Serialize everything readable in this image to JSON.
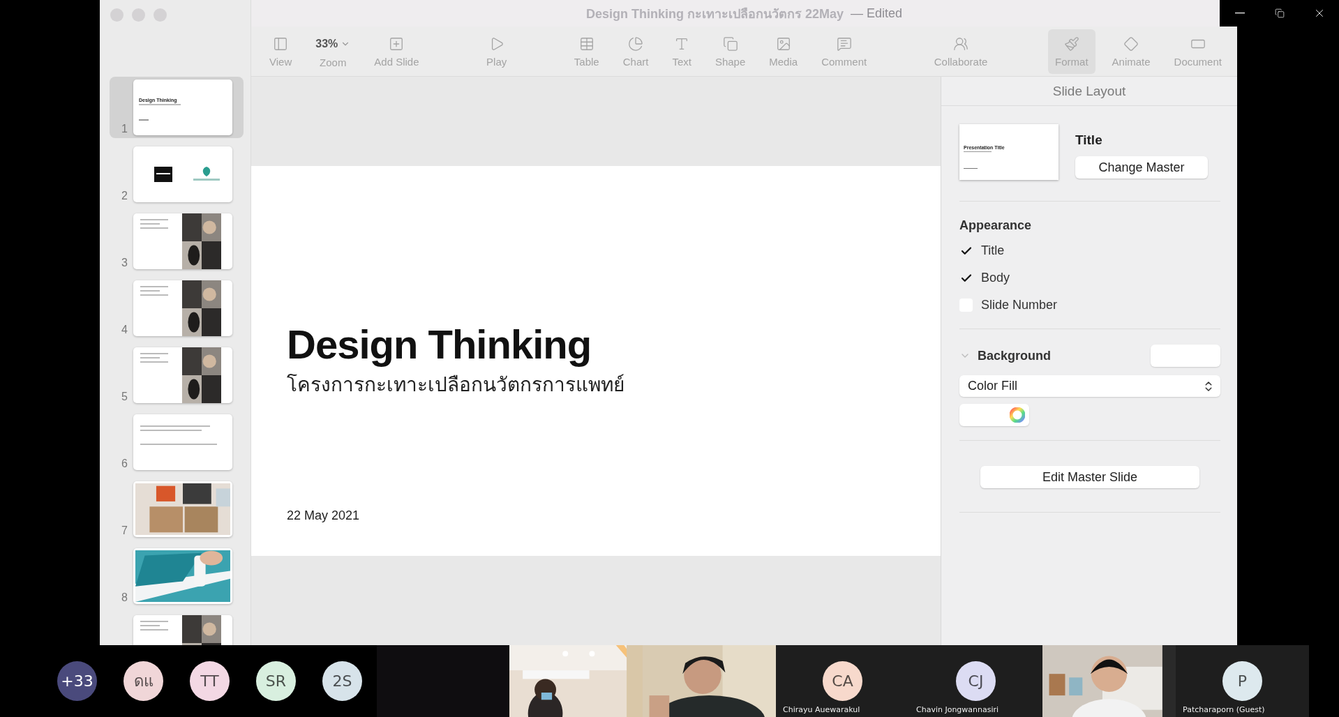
{
  "window": {
    "title": "Design Thinking กะเทาะเปลือกนวัตกร 22May",
    "status": "— Edited"
  },
  "toolbar": {
    "groups": [
      [
        {
          "kind": "view",
          "label": "View",
          "selected": false
        },
        {
          "kind": "zoom",
          "value": "33%",
          "label": "Zoom",
          "selected": false
        },
        {
          "kind": "add-slide",
          "label": "Add Slide",
          "selected": false
        }
      ],
      [
        {
          "kind": "play",
          "label": "Play",
          "selected": false
        }
      ],
      [
        {
          "kind": "table",
          "label": "Table",
          "selected": false
        },
        {
          "kind": "chart",
          "label": "Chart",
          "selected": false
        },
        {
          "kind": "text",
          "label": "Text",
          "selected": false
        },
        {
          "kind": "shape",
          "label": "Shape",
          "selected": false
        },
        {
          "kind": "media",
          "label": "Media",
          "selected": false
        },
        {
          "kind": "comment",
          "label": "Comment",
          "selected": false
        }
      ],
      [
        {
          "kind": "collaborate",
          "label": "Collaborate",
          "selected": false
        }
      ],
      [
        {
          "kind": "format",
          "label": "Format",
          "selected": true
        },
        {
          "kind": "animate",
          "label": "Animate",
          "selected": false
        },
        {
          "kind": "document",
          "label": "Document",
          "selected": false
        }
      ]
    ]
  },
  "slides": [
    {
      "number": "1",
      "kind": "title",
      "title": "Design Thinking",
      "selected": true
    },
    {
      "number": "2",
      "kind": "logos",
      "selected": false
    },
    {
      "number": "3",
      "kind": "collage",
      "selected": false
    },
    {
      "number": "4",
      "kind": "collage",
      "selected": false
    },
    {
      "number": "5",
      "kind": "collage",
      "selected": false
    },
    {
      "number": "6",
      "kind": "text",
      "selected": false
    },
    {
      "number": "7",
      "selected": false
    },
    {
      "number": "8",
      "selected": false
    },
    {
      "kind": "collage",
      "selected": false
    }
  ],
  "canvas": {
    "title": "Design Thinking",
    "subtitle": "โครงการกะเทาะเปลือกนวัตกรการแพทย์",
    "date": "22 May 2021"
  },
  "panel": {
    "header": "Slide Layout",
    "layout_thumbnail_title": "Presentation Title",
    "layout_name": "Title",
    "change_master": "Change Master",
    "appearance_heading": "Appearance",
    "appearance": [
      {
        "label": "Title",
        "checked": true
      },
      {
        "label": "Body",
        "checked": true
      },
      {
        "label": "Slide Number",
        "checked": false
      }
    ],
    "background_heading": "Background",
    "fill": "Color Fill",
    "edit_master": "Edit Master Slide"
  },
  "meeting": {
    "circles": [
      {
        "label": "+33",
        "color": "#4a4a7c"
      },
      {
        "label": "ดแ",
        "color": "#f0d6d8"
      },
      {
        "label": "TT",
        "color": "#f3d8e4"
      },
      {
        "label": "SR",
        "color": "#d8efdf"
      },
      {
        "label": "2S",
        "color": "#d7e3ea"
      }
    ],
    "tiles": [
      {
        "kind": "video"
      },
      {
        "kind": "video"
      },
      {
        "kind": "avatar",
        "initials": "CA",
        "name": "Chirayu Auewarakul",
        "color": "#f7d9cc"
      },
      {
        "kind": "avatar",
        "initials": "CJ",
        "name": "Chavin Jongwannasiri",
        "color": "#dcdcf3"
      },
      {
        "kind": "video"
      },
      {
        "kind": "avatar",
        "initials": "P",
        "name": "Patcharaporn (Guest)",
        "color": "#dde9ee"
      }
    ]
  }
}
